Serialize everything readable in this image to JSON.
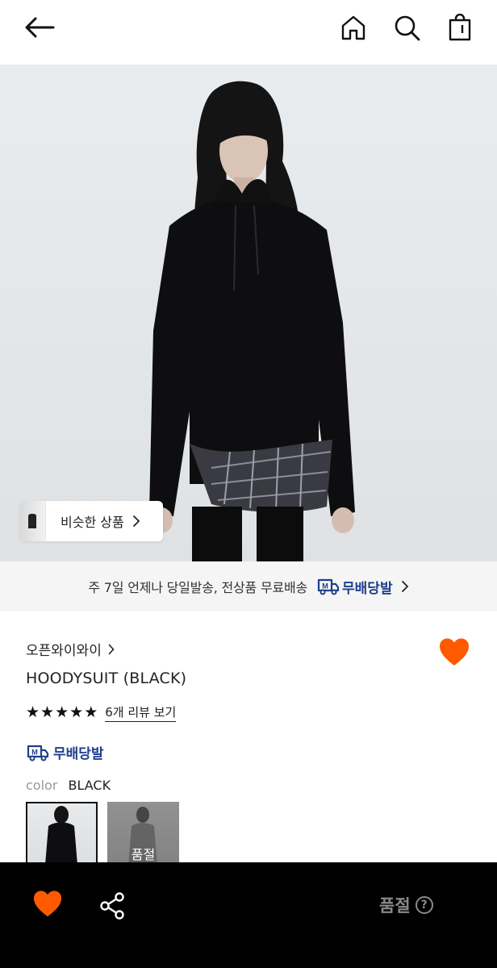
{
  "header": {
    "back_icon": "back-arrow-icon",
    "home_icon": "home-icon",
    "search_icon": "search-icon",
    "bag_icon": "shopping-bag-icon"
  },
  "hero": {
    "similar_label": "비슷한 상품"
  },
  "promo": {
    "text": "주 7일 언제나 당일발송, 전상품 무료배송",
    "badge": "무배당발",
    "badge_mark": "M"
  },
  "product": {
    "brand": "오픈와이와이",
    "title": "HOODYSUIT (BLACK)",
    "rating_stars": 5,
    "review_link": "6개 리뷰 보기",
    "free_ship_badge": "무배당발",
    "color_label": "color",
    "color_value": "BLACK",
    "swatches": [
      {
        "selected": true,
        "sold_out": false
      },
      {
        "selected": false,
        "sold_out": true,
        "tag": "품절"
      }
    ]
  },
  "bottom_bar": {
    "status": "품절",
    "help": "?"
  },
  "colors": {
    "wishlist": "#ff5a00",
    "brand_blue": "#1f3f8c",
    "bottom_bar": "#000000"
  }
}
